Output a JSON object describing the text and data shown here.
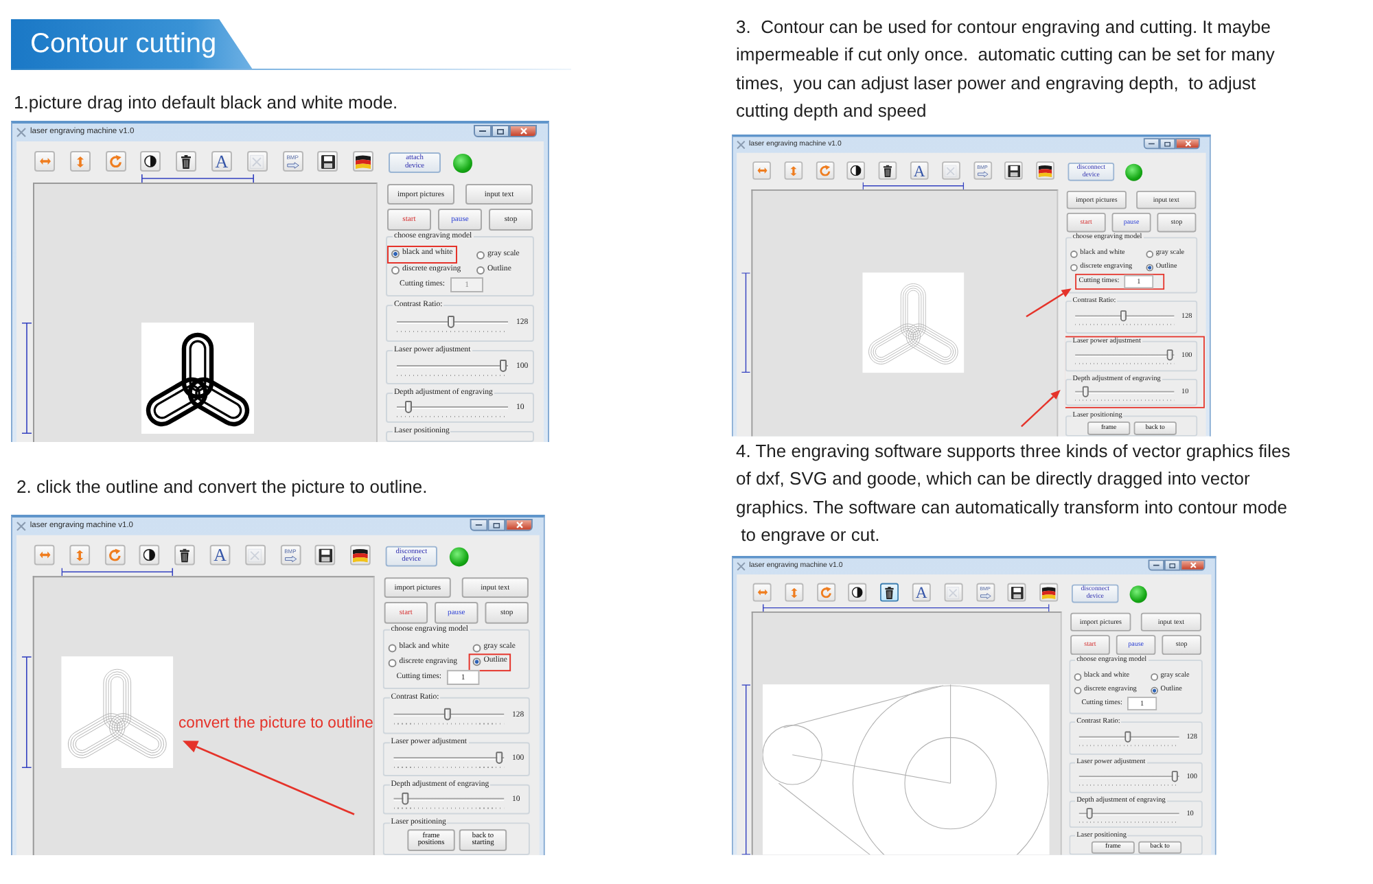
{
  "header": {
    "title": "Contour cutting"
  },
  "steps": [
    {
      "caption": "1.picture drag into default black and white mode.",
      "window": {
        "title": "laser engraving machine v1.0",
        "tools": [
          {
            "kind": "flip-horizontal",
            "disabled": false,
            "hovered": false
          },
          {
            "kind": "flip-vertical",
            "disabled": false,
            "hovered": false
          },
          {
            "kind": "rotate",
            "disabled": false,
            "hovered": false
          },
          {
            "kind": "invert",
            "disabled": false,
            "hovered": false
          },
          {
            "kind": "delete",
            "disabled": false,
            "hovered": false
          },
          {
            "kind": "text",
            "glyph": "A",
            "disabled": false,
            "hovered": false
          },
          {
            "kind": "clear",
            "disabled": true,
            "hovered": false
          },
          {
            "kind": "bmp",
            "glyph": "BMP",
            "disabled": false,
            "hovered": false
          },
          {
            "kind": "save",
            "disabled": false,
            "hovered": false
          },
          {
            "kind": "language",
            "disabled": false,
            "hovered": false
          }
        ],
        "connect_button": "attach device",
        "status_on": true,
        "picture": {
          "kind": "solid-trefoil"
        },
        "file_buttons": [
          "import pictures",
          "input text"
        ],
        "run_buttons": [
          {
            "kind": "start",
            "label": "start"
          },
          {
            "kind": "pause",
            "label": "pause"
          },
          {
            "kind": "stop",
            "label": "stop"
          }
        ],
        "mode_group": {
          "title": "choose engraving model",
          "options": [
            {
              "label": "black and white",
              "selected": true,
              "highlighted": true
            },
            {
              "label": "gray scale",
              "selected": false,
              "highlighted": false
            },
            {
              "label": "discrete engraving",
              "selected": false,
              "highlighted": false
            },
            {
              "label": "Outline",
              "selected": false,
              "highlighted": false
            }
          ]
        },
        "cutting_times": {
          "label": "Cutting times:",
          "value": "1",
          "disabled": true,
          "highlighted": false
        },
        "sliders": [
          {
            "title": "Contrast Ratio:",
            "level": 0.49,
            "reading": "128",
            "highlighted": false
          },
          {
            "title": "Laser power adjustment",
            "level": 0.96,
            "reading": "100",
            "highlighted": false
          },
          {
            "title": "Depth adjustment of engraving",
            "level": 0.11,
            "reading": "10",
            "highlighted": false
          }
        ],
        "positioning": {
          "title": "Laser positioning"
        }
      }
    },
    {
      "caption": "2. click the outline and convert the picture to outline.",
      "annotation": "convert the picture to outline",
      "window": {
        "title": "laser engraving machine v1.0",
        "tools": [
          {
            "kind": "flip-horizontal",
            "disabled": false,
            "hovered": false
          },
          {
            "kind": "flip-vertical",
            "disabled": false,
            "hovered": false
          },
          {
            "kind": "rotate",
            "disabled": false,
            "hovered": false
          },
          {
            "kind": "invert",
            "disabled": false,
            "hovered": false
          },
          {
            "kind": "delete",
            "disabled": false,
            "hovered": false
          },
          {
            "kind": "text",
            "glyph": "A",
            "disabled": false,
            "hovered": false
          },
          {
            "kind": "clear",
            "disabled": true,
            "hovered": false
          },
          {
            "kind": "bmp",
            "glyph": "BMP",
            "disabled": false,
            "hovered": false
          },
          {
            "kind": "save",
            "disabled": false,
            "hovered": false
          },
          {
            "kind": "language",
            "disabled": false,
            "hovered": false
          }
        ],
        "connect_button": "disconnect device",
        "status_on": true,
        "picture": {
          "kind": "outline-trefoil"
        },
        "file_buttons": [
          "import pictures",
          "input text"
        ],
        "run_buttons": [
          {
            "kind": "start",
            "label": "start"
          },
          {
            "kind": "pause",
            "label": "pause"
          },
          {
            "kind": "stop",
            "label": "stop"
          }
        ],
        "mode_group": {
          "title": "choose engraving model",
          "options": [
            {
              "label": "black and white",
              "selected": false,
              "highlighted": false
            },
            {
              "label": "gray scale",
              "selected": false,
              "highlighted": false
            },
            {
              "label": "discrete engraving",
              "selected": false,
              "highlighted": false
            },
            {
              "label": "Outline",
              "selected": true,
              "highlighted": true
            }
          ]
        },
        "cutting_times": {
          "label": "Cutting times:",
          "value": "1",
          "disabled": false,
          "highlighted": false
        },
        "sliders": [
          {
            "title": "Contrast Ratio:",
            "level": 0.49,
            "reading": "128",
            "highlighted": false
          },
          {
            "title": "Laser power adjustment",
            "level": 0.96,
            "reading": "100",
            "highlighted": false
          },
          {
            "title": "Depth adjustment of engraving",
            "level": 0.11,
            "reading": "10",
            "highlighted": false
          }
        ],
        "positioning": {
          "title": "Laser positioning",
          "buttons": [
            "frame positions",
            "back to starting"
          ]
        }
      }
    },
    {
      "caption": "3.  Contour can be used for contour engraving and cutting. It maybe\nimpermeable if cut only once.  automatic cutting can be set for many\ntimes,  you can adjust laser power and engraving depth,  to adjust\ncutting depth and speed",
      "window": {
        "title": "laser engraving machine v1.0",
        "tools": [
          {
            "kind": "flip-horizontal",
            "disabled": false,
            "hovered": false
          },
          {
            "kind": "flip-vertical",
            "disabled": false,
            "hovered": false
          },
          {
            "kind": "rotate",
            "disabled": false,
            "hovered": false
          },
          {
            "kind": "invert",
            "disabled": false,
            "hovered": false
          },
          {
            "kind": "delete",
            "disabled": false,
            "hovered": false
          },
          {
            "kind": "text",
            "glyph": "A",
            "disabled": false,
            "hovered": false
          },
          {
            "kind": "clear",
            "disabled": true,
            "hovered": false
          },
          {
            "kind": "bmp",
            "glyph": "BMP",
            "disabled": false,
            "hovered": false
          },
          {
            "kind": "save",
            "disabled": false,
            "hovered": false
          },
          {
            "kind": "language",
            "disabled": false,
            "hovered": false
          }
        ],
        "connect_button": "disconnect device",
        "status_on": true,
        "picture": {
          "kind": "outline-trefoil"
        },
        "file_buttons": [
          "import pictures",
          "input text"
        ],
        "run_buttons": [
          {
            "kind": "start",
            "label": "start"
          },
          {
            "kind": "pause",
            "label": "pause"
          },
          {
            "kind": "stop",
            "label": "stop"
          }
        ],
        "mode_group": {
          "title": "choose engraving model",
          "options": [
            {
              "label": "black and white",
              "selected": false,
              "highlighted": false
            },
            {
              "label": "gray scale",
              "selected": false,
              "highlighted": false
            },
            {
              "label": "discrete engraving",
              "selected": false,
              "highlighted": false
            },
            {
              "label": "Outline",
              "selected": true,
              "highlighted": false
            }
          ]
        },
        "cutting_times": {
          "label": "Cutting times:",
          "value": "1",
          "disabled": false,
          "highlighted": true
        },
        "sliders": [
          {
            "title": "Contrast Ratio:",
            "level": 0.49,
            "reading": "128",
            "highlighted": false
          },
          {
            "title": "Laser power adjustment",
            "level": 0.96,
            "reading": "100",
            "highlighted": true
          },
          {
            "title": "Depth adjustment of engraving",
            "level": 0.11,
            "reading": "10",
            "highlighted": true
          }
        ],
        "positioning": {
          "title": "Laser positioning",
          "buttons": [
            "frame",
            "back to"
          ]
        }
      }
    },
    {
      "caption": "4. The engraving software supports three kinds of vector graphics files\nof dxf, SVG and goode, which can be directly dragged into vector\ngraphics. The software can automatically transform into contour mode\n to engrave or cut.",
      "window": {
        "title": "laser engraving machine v1.0",
        "tools": [
          {
            "kind": "flip-horizontal",
            "disabled": false,
            "hovered": false
          },
          {
            "kind": "flip-vertical",
            "disabled": false,
            "hovered": false
          },
          {
            "kind": "rotate",
            "disabled": false,
            "hovered": false
          },
          {
            "kind": "invert",
            "disabled": false,
            "hovered": false
          },
          {
            "kind": "delete",
            "disabled": false,
            "hovered": true
          },
          {
            "kind": "text",
            "glyph": "A",
            "disabled": false,
            "hovered": false
          },
          {
            "kind": "clear",
            "disabled": true,
            "hovered": false
          },
          {
            "kind": "bmp",
            "glyph": "BMP",
            "disabled": false,
            "hovered": false
          },
          {
            "kind": "save",
            "disabled": false,
            "hovered": false
          },
          {
            "kind": "language",
            "disabled": false,
            "hovered": false
          }
        ],
        "connect_button": "disconnect device",
        "status_on": true,
        "picture": {
          "kind": "vector-shapes"
        },
        "file_buttons": [
          "import pictures",
          "input text"
        ],
        "run_buttons": [
          {
            "kind": "start",
            "label": "start"
          },
          {
            "kind": "pause",
            "label": "pause"
          },
          {
            "kind": "stop",
            "label": "stop"
          }
        ],
        "mode_group": {
          "title": "choose engraving model",
          "options": [
            {
              "label": "black and white",
              "selected": false,
              "highlighted": false
            },
            {
              "label": "gray scale",
              "selected": false,
              "highlighted": false
            },
            {
              "label": "discrete engraving",
              "selected": false,
              "highlighted": false
            },
            {
              "label": "Outline",
              "selected": true,
              "highlighted": false
            }
          ]
        },
        "cutting_times": {
          "label": "Cutting times:",
          "value": "1",
          "disabled": false,
          "highlighted": false
        },
        "sliders": [
          {
            "title": "Contrast Ratio:",
            "level": 0.49,
            "reading": "128",
            "highlighted": false
          },
          {
            "title": "Laser power adjustment",
            "level": 0.96,
            "reading": "100",
            "highlighted": false
          },
          {
            "title": "Depth adjustment of engraving",
            "level": 0.11,
            "reading": "10",
            "highlighted": false
          }
        ],
        "positioning": {
          "title": "Laser positioning",
          "buttons": [
            "frame",
            "back to"
          ]
        }
      }
    }
  ]
}
